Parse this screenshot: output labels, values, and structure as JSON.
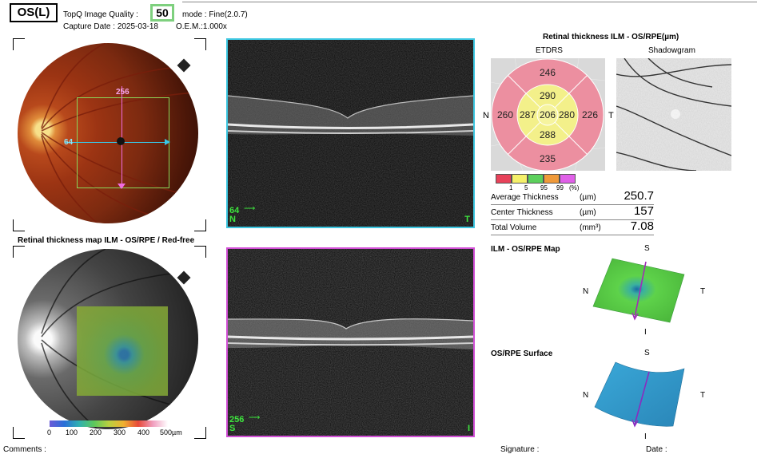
{
  "header": {
    "eye": "OS(L)",
    "quality_label": "TopQ Image Quality :",
    "quality_value": "50",
    "mode": "mode : Fine(2.0.7)",
    "capture_date": "Capture Date : 2025-03-18",
    "oem": "O.E.M.:1.000x"
  },
  "fundus_top": {
    "vert_value": "256",
    "horiz_value": "64"
  },
  "bscan_top": {
    "frame_number": "64",
    "left_label": "N",
    "right_label": "T",
    "border_color": "#3cc6e0"
  },
  "bscan_bottom": {
    "frame_number": "256",
    "left_label": "S",
    "right_label": "I",
    "border_color": "#d24fd6"
  },
  "map_section": {
    "title": "Retinal thickness map ILM - OS/RPE / Red-free",
    "scale_ticks": [
      "0",
      "100",
      "200",
      "300",
      "400",
      "500µm"
    ]
  },
  "thickness": {
    "title": "Retinal thickness ILM - OS/RPE(µm)",
    "etdrs_label": "ETDRS",
    "shadowgram_label": "Shadowgram",
    "nasal": "N",
    "temporal": "T",
    "sectors": {
      "outer_superior": "246",
      "outer_nasal": "260",
      "outer_temporal": "226",
      "outer_inferior": "235",
      "inner_superior": "290",
      "inner_nasal": "287",
      "center": "206",
      "inner_temporal": "280",
      "inner_inferior": "288"
    },
    "legend_ticks": [
      "1",
      "5",
      "95",
      "99",
      "(%)"
    ],
    "legend_colors": [
      "#e8425a",
      "#f5f06a",
      "#5cd05c",
      "#f09a3a",
      "#e060e8"
    ],
    "outer_color": "#ec8fa0",
    "inner_color": "#f3f08a",
    "center_color": "#f6f49e"
  },
  "metrics": [
    {
      "label": "Average Thickness",
      "unit": "(µm)",
      "value": "250.7"
    },
    {
      "label": "Center Thickness",
      "unit": "(µm)",
      "value": "157"
    },
    {
      "label": "Total Volume",
      "unit": "(mm³)",
      "value": "7.08"
    }
  ],
  "map3d": {
    "title": "ILM - OS/RPE Map",
    "s": "S",
    "i": "I",
    "n": "N",
    "t": "T"
  },
  "surface3d": {
    "title": "OS/RPE Surface",
    "s": "S",
    "i": "I",
    "n": "N",
    "t": "T"
  },
  "footer": {
    "comments": "Comments :",
    "signature": "Signature :",
    "date": "Date :"
  }
}
